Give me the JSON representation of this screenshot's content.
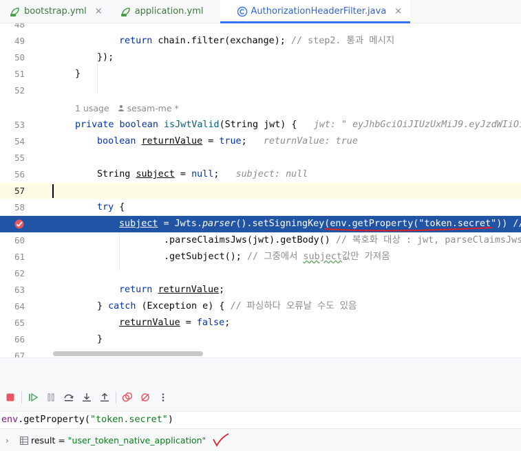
{
  "tabs": [
    {
      "label": "bootstrap.yml",
      "icon": "yml-file-icon",
      "close": "×"
    },
    {
      "label": "application.yml",
      "icon": "yml-file-icon",
      "close": ""
    },
    {
      "label": "AuthorizationHeaderFilter.java",
      "icon": "java-class-icon",
      "close": "×",
      "active": true
    }
  ],
  "editor": {
    "line_numbers": [
      "48",
      "49",
      "50",
      "51",
      "52",
      "53",
      "54",
      "55",
      "56",
      "57",
      "58",
      "59",
      "60",
      "61",
      "62",
      "63",
      "64",
      "65",
      "66",
      "67"
    ],
    "line49": {
      "kw": "return",
      "text": " chain.filter(exchange); ",
      "comment": "// step2. 통과 메시지"
    },
    "line50": "});",
    "line51": "}",
    "usage_hint": {
      "usage": "1 usage",
      "author": "sesam-me *"
    },
    "line53": {
      "kw1": "private",
      "kw2": "boolean",
      "method": "isJwtValid",
      "params": "(String jwt) {",
      "hint": "jwt: \" eyJhbGciOiJIUzUxMiJ9.eyJzdWIiOiI"
    },
    "line54": {
      "kw": "boolean",
      "var": "returnValue",
      "eq": " = ",
      "val": "true",
      "semi": ";",
      "hint": "returnValue: true"
    },
    "line56": {
      "type": "String",
      "var": "subject",
      "eq": " = ",
      "val": "null",
      "semi": ";",
      "hint": "subject: null"
    },
    "line58": {
      "kw": "try",
      "rest": " {"
    },
    "line59": {
      "var": "subject",
      "a": " = Jwts.",
      "parser": "parser",
      "b": "().setSigningKey(",
      "env": "env",
      "c": ".getProperty(",
      "str": "\"token.secret\"",
      "d": ")) //"
    },
    "line60": {
      "text": ".parseClaimsJws(jwt).getBody() ",
      "comment": "// 복호화 대상 : jwt, parseClaimsJws"
    },
    "line61": {
      "text": ".getSubject(); ",
      "comment_a": "// 그중에서 ",
      "comment_ul": "subject",
      "comment_b": "값만 가져옴"
    },
    "line63": {
      "kw": "return",
      "var": "returnValue",
      "semi": ";"
    },
    "line64": {
      "a": "} ",
      "kw": "catch",
      "b": " (Exception e) { ",
      "comment": "// 파싱하다 오류날 수도 있음"
    },
    "line65": {
      "var": "returnValue",
      "eq": " = ",
      "val": "false",
      "semi": ";"
    },
    "line66": "}"
  },
  "debug": {
    "expression": {
      "env": "env",
      "a": ".getProperty(",
      "str": "\"token.secret\"",
      "b": ")"
    },
    "result": {
      "arrow": "›",
      "name": "result",
      "eq": " = ",
      "value": "\"user_token_native_application\""
    }
  },
  "colors": {
    "execution_line": "#2154a4",
    "keyword": "#0033b3",
    "string": "#067d17",
    "annotation_red": "#e02020"
  }
}
